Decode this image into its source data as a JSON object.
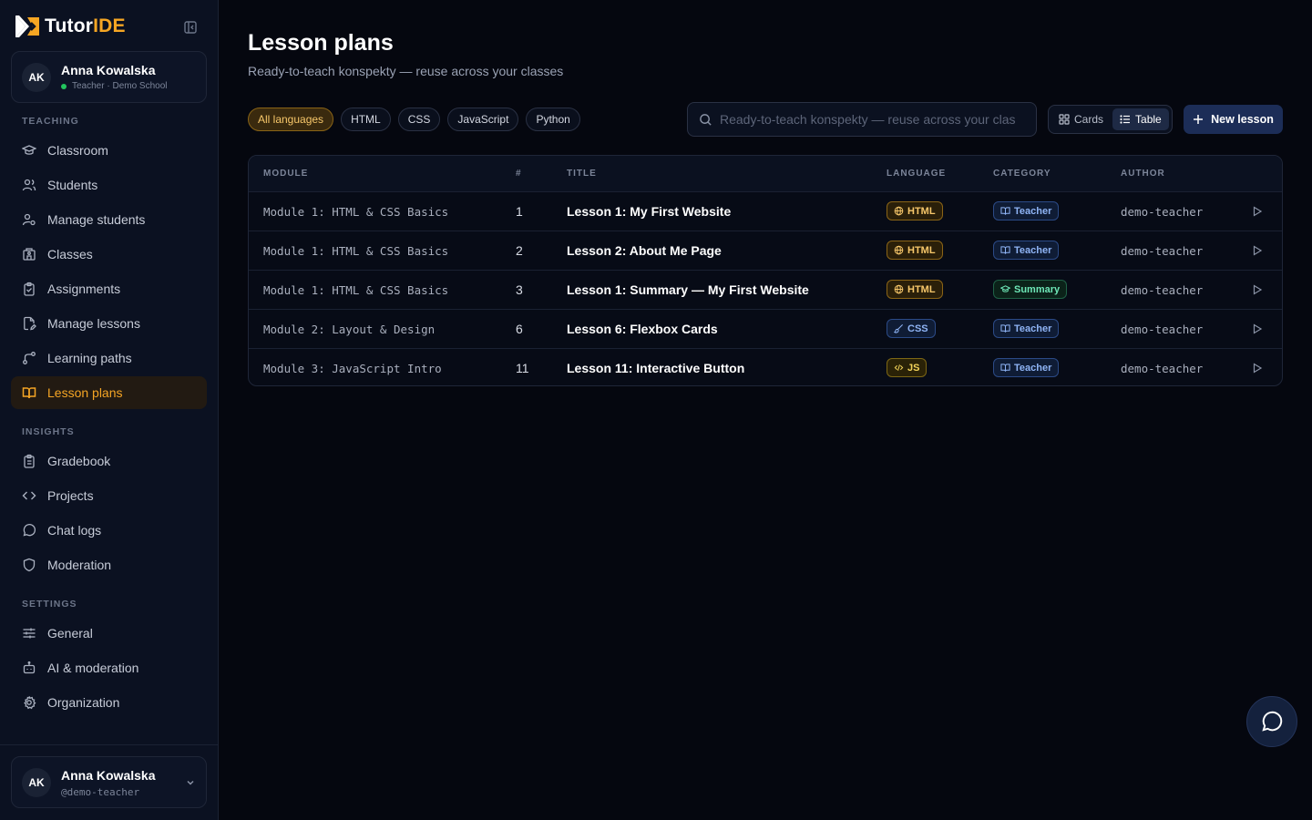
{
  "brand": {
    "name_prefix": "Tutor",
    "name_suffix": "IDE"
  },
  "user": {
    "initials": "AK",
    "name": "Anna Kowalska",
    "role": "Teacher",
    "school": "· Demo School",
    "handle": "@demo-teacher"
  },
  "sidebar": {
    "teaching_label": "TEACHING",
    "teaching": [
      "Classroom",
      "Students",
      "Manage students",
      "Classes",
      "Assignments",
      "Manage lessons",
      "Learning paths",
      "Lesson plans"
    ],
    "insights_label": "INSIGHTS",
    "insights": [
      "Gradebook",
      "Projects",
      "Chat logs",
      "Moderation"
    ],
    "settings_label": "SETTINGS",
    "settings": [
      "General",
      "AI & moderation",
      "Organization"
    ]
  },
  "page": {
    "title": "Lesson plans",
    "subtitle": "Ready-to-teach konspekty — reuse across your classes"
  },
  "filters": [
    "All languages",
    "HTML",
    "CSS",
    "JavaScript",
    "Python"
  ],
  "search": {
    "placeholder": "Ready-to-teach konspekty — reuse across your clas"
  },
  "view": {
    "cards": "Cards",
    "table": "Table",
    "selected": "Table"
  },
  "new_lesson_label": "New lesson",
  "table": {
    "headers": [
      "MODULE",
      "#",
      "TITLE",
      "LANGUAGE",
      "CATEGORY",
      "AUTHOR"
    ],
    "rows": [
      {
        "module": "Module 1: HTML & CSS Basics",
        "num": "1",
        "title": "Lesson 1: My First Website",
        "language": "HTML",
        "category": "Teacher",
        "author": "demo-teacher"
      },
      {
        "module": "Module 1: HTML & CSS Basics",
        "num": "2",
        "title": "Lesson 2: About Me Page",
        "language": "HTML",
        "category": "Teacher",
        "author": "demo-teacher"
      },
      {
        "module": "Module 1: HTML & CSS Basics",
        "num": "3",
        "title": "Lesson 1: Summary — My First Website",
        "language": "HTML",
        "category": "Summary",
        "author": "demo-teacher"
      },
      {
        "module": "Module 2: Layout & Design",
        "num": "6",
        "title": "Lesson 6: Flexbox Cards",
        "language": "CSS",
        "category": "Teacher",
        "author": "demo-teacher"
      },
      {
        "module": "Module 3: JavaScript Intro",
        "num": "11",
        "title": "Lesson 11: Interactive Button",
        "language": "JS",
        "category": "Teacher",
        "author": "demo-teacher"
      }
    ]
  },
  "colors": {
    "accent": "#f5a524",
    "background": "#05070f",
    "sidebar": "#0b1121",
    "primary_button": "#1c2d57"
  }
}
